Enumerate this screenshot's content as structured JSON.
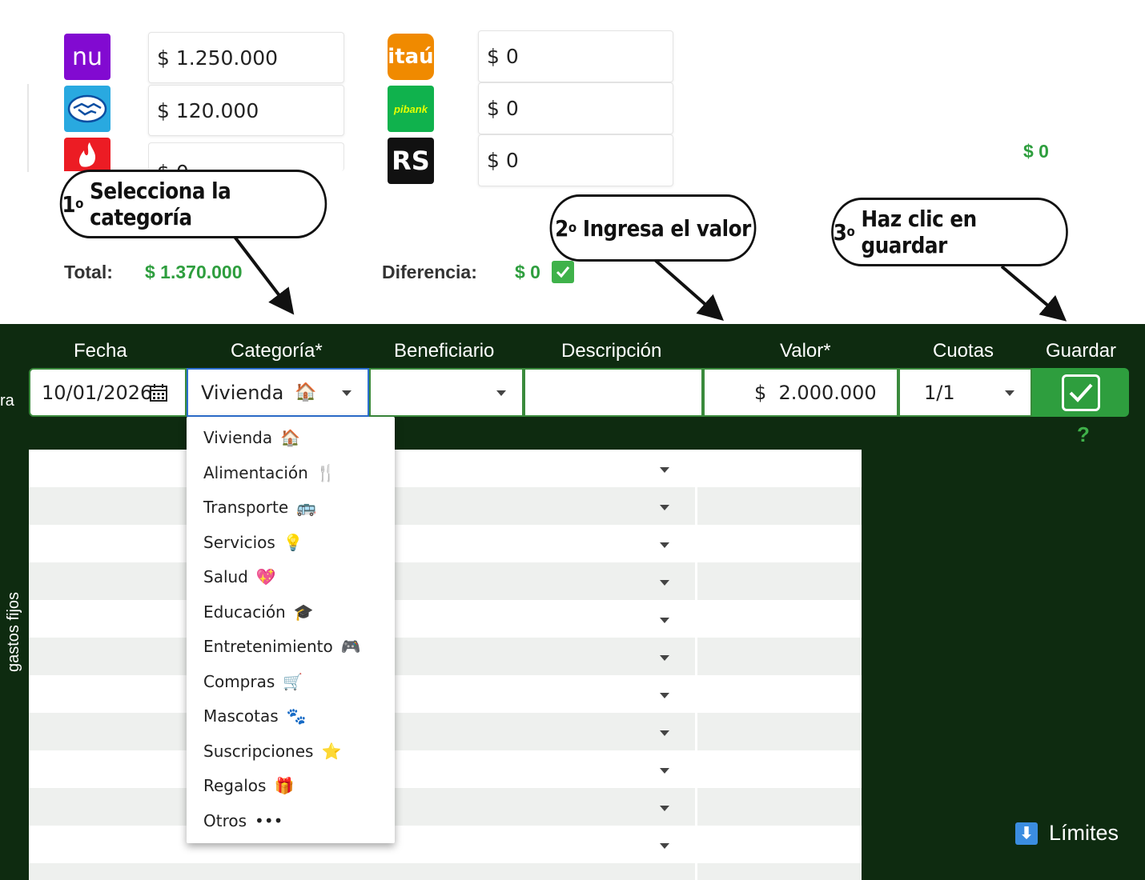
{
  "accounts": {
    "nu": {
      "logo_text": "nu",
      "color": "#820ad1",
      "value": "$ 1.250.000"
    },
    "mercadopago": {
      "logo_icon": "handshake-icon",
      "color": "#29a9e0",
      "value": "$ 120.000"
    },
    "santander": {
      "logo_icon": "flame-icon",
      "color": "#ec1c24",
      "value": "$ 0"
    },
    "itau": {
      "logo_text": "itaú",
      "color": "#f08a00",
      "value": "$ 0"
    },
    "pibank": {
      "logo_text": "pibank",
      "color": "#10b24d",
      "value": "$ 0"
    },
    "rs": {
      "logo_text": "RS",
      "color": "#111111",
      "value": "$ 0"
    }
  },
  "side_total": "$ 0",
  "totals": {
    "total_label": "Total:",
    "total_value": "$ 1.370.000",
    "diff_label": "Diferencia:",
    "diff_value": "$ 0"
  },
  "callouts": {
    "step1": {
      "num": "1",
      "sup": "o",
      "text": "Selecciona la categoría"
    },
    "step2": {
      "num": "2",
      "sup": "o",
      "text": "Ingresa el valor"
    },
    "step3": {
      "num": "3",
      "sup": "o",
      "text": "Haz clic en guardar"
    }
  },
  "form": {
    "headers": {
      "fecha": "Fecha",
      "categoria": "Categoría*",
      "beneficiario": "Beneficiario",
      "descripcion": "Descripción",
      "valor": "Valor*",
      "cuotas": "Cuotas",
      "guardar": "Guardar"
    },
    "fecha_value": "10/01/2026",
    "categoria_value": "Vivienda",
    "categoria_icon": "🏠",
    "beneficiario_value": "",
    "descripcion_value": "",
    "valor_value": "$  2.000.000",
    "cuotas_value": "1/1",
    "help": "?"
  },
  "side_labels": {
    "ra": "ra",
    "vertical": "gastos fijos"
  },
  "categories": [
    {
      "label": "Vivienda",
      "icon": "🏠",
      "icon_name": "house-icon"
    },
    {
      "label": "Alimentación",
      "icon": "🍴",
      "icon_name": "fork-knife-icon"
    },
    {
      "label": "Transporte",
      "icon": "🚌",
      "icon_name": "bus-icon"
    },
    {
      "label": "Servicios",
      "icon": "💡",
      "icon_name": "lightbulb-icon"
    },
    {
      "label": "Salud",
      "icon": "💖",
      "icon_name": "heart-icon"
    },
    {
      "label": "Educación",
      "icon": "🎓",
      "icon_name": "graduation-cap-icon"
    },
    {
      "label": "Entretenimiento",
      "icon": "🎮",
      "icon_name": "gamepad-icon"
    },
    {
      "label": "Compras",
      "icon": "🛒",
      "icon_name": "cart-icon"
    },
    {
      "label": "Mascotas",
      "icon": "🐾",
      "icon_name": "paw-icon"
    },
    {
      "label": "Suscripciones",
      "icon": "⭐",
      "icon_name": "star-icon"
    },
    {
      "label": "Regalos",
      "icon": "🎁",
      "icon_name": "gift-icon"
    },
    {
      "label": "Otros",
      "icon": "•••",
      "icon_name": "ellipsis-icon"
    }
  ],
  "limites": {
    "label": "Límites",
    "icon": "⬇"
  }
}
